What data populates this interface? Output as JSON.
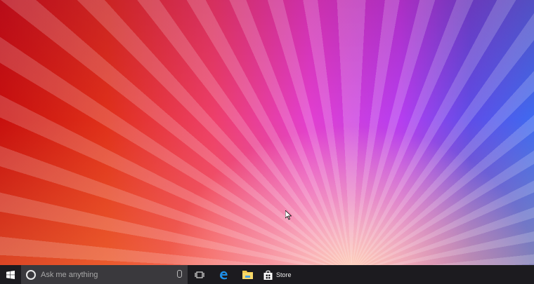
{
  "taskbar": {
    "search_placeholder": "Ask me anything",
    "apps": [
      {
        "name": "Task View"
      },
      {
        "name": "Microsoft Edge"
      },
      {
        "name": "File Explorer"
      },
      {
        "name": "Store",
        "label": "Store"
      }
    ]
  }
}
